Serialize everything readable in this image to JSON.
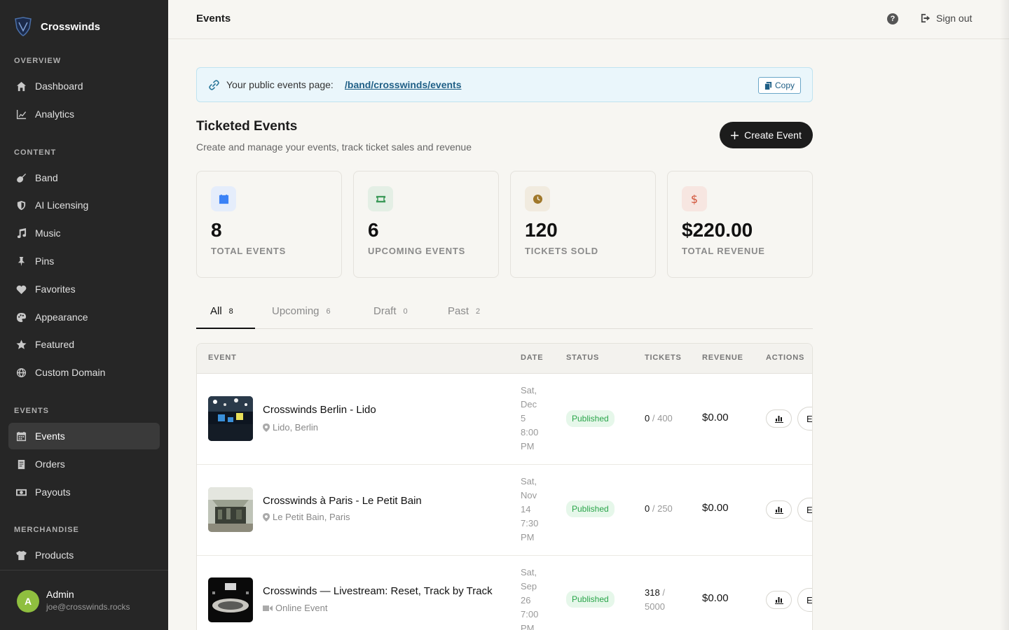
{
  "brand": {
    "name": "Crosswinds"
  },
  "sidebar": {
    "sections": [
      {
        "title": "OVERVIEW",
        "items": [
          {
            "label": "Dashboard",
            "icon": "home-icon"
          },
          {
            "label": "Analytics",
            "icon": "chart-line-icon"
          }
        ]
      },
      {
        "title": "CONTENT",
        "items": [
          {
            "label": "Band",
            "icon": "guitar-icon"
          },
          {
            "label": "AI Licensing",
            "icon": "shield-icon"
          },
          {
            "label": "Music",
            "icon": "music-note-icon"
          },
          {
            "label": "Pins",
            "icon": "pin-icon"
          },
          {
            "label": "Favorites",
            "icon": "heart-icon"
          },
          {
            "label": "Appearance",
            "icon": "palette-icon"
          },
          {
            "label": "Featured",
            "icon": "star-icon"
          },
          {
            "label": "Custom Domain",
            "icon": "globe-icon"
          }
        ]
      },
      {
        "title": "EVENTS",
        "items": [
          {
            "label": "Events",
            "icon": "calendar-icon",
            "active": true
          },
          {
            "label": "Orders",
            "icon": "receipt-icon"
          },
          {
            "label": "Payouts",
            "icon": "money-icon"
          }
        ]
      },
      {
        "title": "MERCHANDISE",
        "items": [
          {
            "label": "Products",
            "icon": "shirt-icon"
          }
        ]
      }
    ],
    "user": {
      "initial": "A",
      "name": "Admin",
      "email": "joe@crosswinds.rocks"
    }
  },
  "topbar": {
    "title": "Events",
    "help": "?",
    "signout_label": "Sign out"
  },
  "public_page": {
    "text": "Your public events page:",
    "url": "/band/crosswinds/events",
    "copy_label": "Copy"
  },
  "header": {
    "title": "Ticketed Events",
    "subtitle": "Create and manage your events, track ticket sales and revenue",
    "create_label": "Create Event"
  },
  "stats": [
    {
      "value": "8",
      "label": "TOTAL EVENTS",
      "icon": "calendar-icon",
      "color": "#3b82f6",
      "bg": "#e5edfb"
    },
    {
      "value": "6",
      "label": "UPCOMING EVENTS",
      "icon": "ticket-icon",
      "color": "#3d9a5a",
      "bg": "#e4efe5"
    },
    {
      "value": "120",
      "label": "TICKETS SOLD",
      "icon": "clock-icon",
      "color": "#a0782a",
      "bg": "#f1ebdf"
    },
    {
      "value": "$220.00",
      "label": "TOTAL REVENUE",
      "icon": "dollar-icon",
      "color": "#d2553a",
      "bg": "#f7e6e1"
    }
  ],
  "tabs": [
    {
      "label": "All",
      "count": "8",
      "active": true
    },
    {
      "label": "Upcoming",
      "count": "6"
    },
    {
      "label": "Draft",
      "count": "0"
    },
    {
      "label": "Past",
      "count": "2"
    }
  ],
  "table": {
    "columns": [
      "EVENT",
      "DATE",
      "STATUS",
      "TICKETS",
      "REVENUE",
      "ACTIONS"
    ],
    "rows": [
      {
        "title": "Crosswinds Berlin - Lido",
        "location": "Lido, Berlin",
        "location_icon": "map-pin-icon",
        "date_lines": [
          "Sat,",
          "Dec",
          "5",
          "8:00",
          "PM"
        ],
        "status": "Published",
        "sold": "0",
        "capacity": "/ 400",
        "revenue": "$0.00",
        "edit_label": "Edit"
      },
      {
        "title": "Crosswinds à Paris - Le Petit Bain",
        "location": "Le Petit Bain, Paris",
        "location_icon": "map-pin-icon",
        "date_lines": [
          "Sat,",
          "Nov",
          "14",
          "7:30",
          "PM"
        ],
        "status": "Published",
        "sold": "0",
        "capacity": "/ 250",
        "revenue": "$0.00",
        "edit_label": "Edit"
      },
      {
        "title": "Crosswinds — Livestream: Reset, Track by Track",
        "location": "Online Event",
        "location_icon": "video-icon",
        "date_lines": [
          "Sat,",
          "Sep",
          "26",
          "7:00",
          "PM"
        ],
        "status": "Published",
        "sold": "318",
        "capacity": "/ 5000",
        "revenue": "$0.00",
        "edit_label": "Edit"
      }
    ]
  }
}
